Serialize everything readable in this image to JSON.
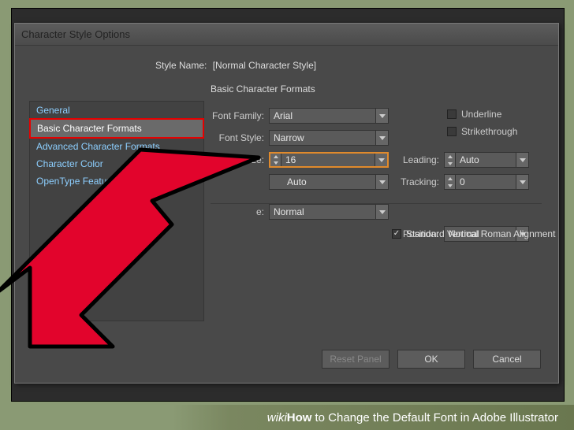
{
  "dialog": {
    "title": "Character Style Options",
    "style_name_label": "Style Name:",
    "style_name_value": "[Normal Character Style]",
    "section_title": "Basic Character Formats"
  },
  "sidebar": {
    "items": [
      {
        "label": "General"
      },
      {
        "label": "Basic Character Formats"
      },
      {
        "label": "Advanced Character Formats"
      },
      {
        "label": "Character Color"
      },
      {
        "label": "OpenType Features"
      }
    ]
  },
  "form": {
    "font_family_label": "Font Family:",
    "font_family_value": "Arial",
    "font_style_label": "Font Style:",
    "font_style_value": "Narrow",
    "size_label": "Size:",
    "size_value": "16",
    "kerning_value": "Auto",
    "case_label": "e:",
    "case_value": "Normal",
    "leading_label": "Leading:",
    "leading_value": "Auto",
    "tracking_label": "Tracking:",
    "tracking_value": "0",
    "position_label": "Position:",
    "position_value": "Normal",
    "underline_label": "Underline",
    "strikethrough_label": "Strikethrough",
    "vertical_align_label": "Standard Vertical Roman Alignment"
  },
  "buttons": {
    "reset": "Reset Panel",
    "ok": "OK",
    "cancel": "Cancel"
  },
  "caption": {
    "wiki": "wiki",
    "how": "How",
    "text": " to Change the Default Font in Adobe Illustrator"
  }
}
